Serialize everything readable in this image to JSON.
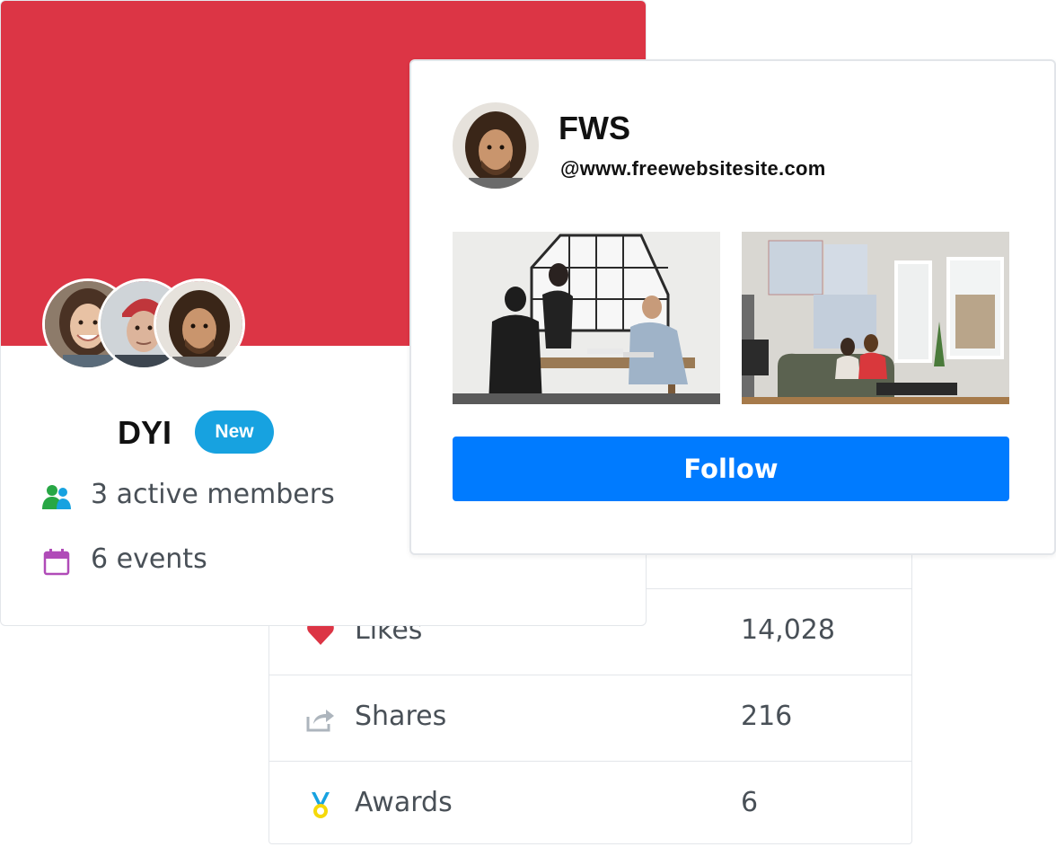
{
  "group": {
    "name": "DYI",
    "badge": "New",
    "members_text": "3 active members",
    "events_text": "6 events",
    "cover_color": "#dc3545",
    "badge_color": "#17a2e0"
  },
  "profile": {
    "name": "FWS",
    "handle": "@www.freewebsitesite.com",
    "follow_label": "Follow",
    "follow_color": "#007bff"
  },
  "stats": [
    {
      "icon": "heart-icon",
      "label": "Likes",
      "value": "14,028"
    },
    {
      "icon": "share-icon",
      "label": "Shares",
      "value": "216"
    },
    {
      "icon": "medal-icon",
      "label": "Awards",
      "value": "6"
    }
  ]
}
